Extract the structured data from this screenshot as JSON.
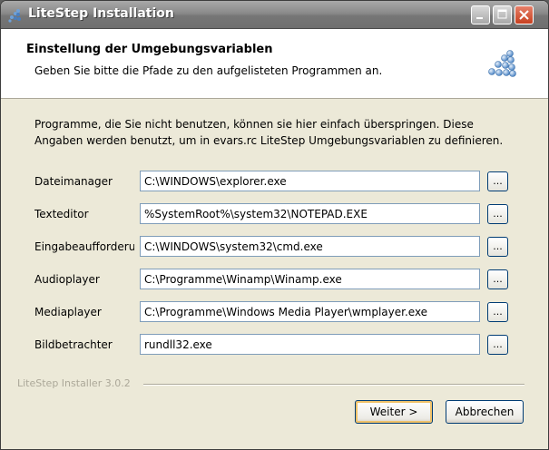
{
  "window": {
    "title": "LiteStep Installation"
  },
  "header": {
    "title": "Einstellung der Umgebungsvariablen",
    "subtitle": "Geben Sie bitte die Pfade zu den aufgelisteten Programmen an."
  },
  "intro": {
    "text": "Programme, die Sie nicht benutzen, können sie hier einfach überspringen. Diese Angaben werden benutzt, um in evars.rc LiteStep Umgebungsvariablen zu definieren."
  },
  "fields": [
    {
      "label": "Dateimanager",
      "value": "C:\\WINDOWS\\explorer.exe"
    },
    {
      "label": "Texteditor",
      "value": "%SystemRoot%\\system32\\NOTEPAD.EXE"
    },
    {
      "label": "Eingabeaufforderung",
      "value": "C:\\WINDOWS\\system32\\cmd.exe"
    },
    {
      "label": "Audioplayer",
      "value": "C:\\Programme\\Winamp\\Winamp.exe"
    },
    {
      "label": "Mediaplayer",
      "value": "C:\\Programme\\Windows Media Player\\wmplayer.exe"
    },
    {
      "label": "Bildbetrachter",
      "value": "rundll32.exe"
    }
  ],
  "browse_label": "...",
  "footer": {
    "version": "LiteStep Installer 3.0.2",
    "next_label": "Weiter >",
    "cancel_label": "Abbrechen"
  },
  "colors": {
    "title_bar": "#8a8a8a",
    "dialog_background": "#ece9d8",
    "input_border": "#7f9db9",
    "button_border": "#003c74",
    "default_button_highlight": "#f0c26a",
    "close_button": "#c7401f"
  }
}
